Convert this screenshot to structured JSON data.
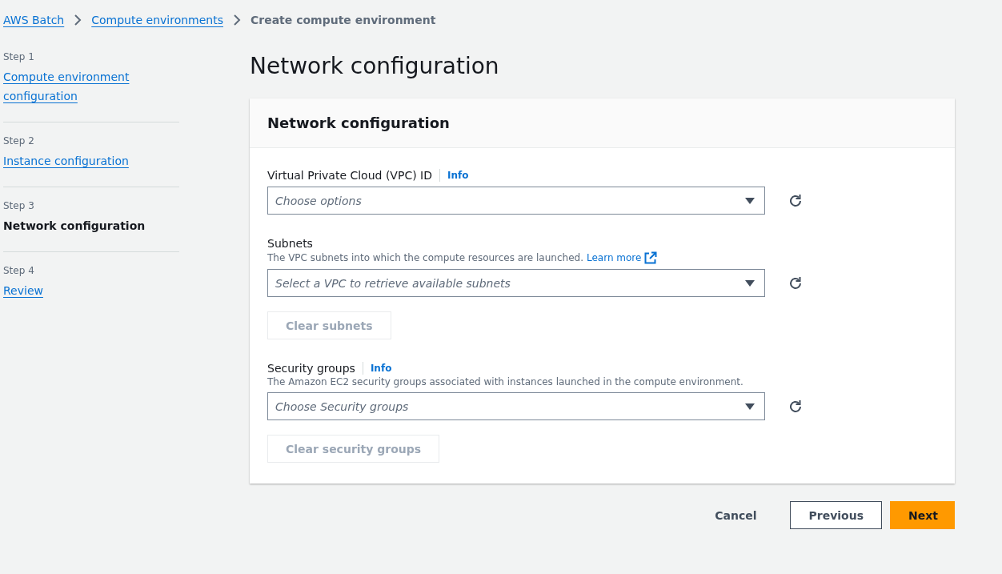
{
  "breadcrumb": [
    {
      "label": "AWS Batch",
      "link": true
    },
    {
      "label": "Compute environments",
      "link": true
    },
    {
      "label": "Create compute environment",
      "link": false
    }
  ],
  "steps": [
    {
      "step": "Step 1",
      "title": "Compute environment configuration",
      "selected": false
    },
    {
      "step": "Step 2",
      "title": "Instance configuration",
      "selected": false
    },
    {
      "step": "Step 3",
      "title": "Network configuration",
      "selected": true
    },
    {
      "step": "Step 4",
      "title": "Review",
      "selected": false
    }
  ],
  "page_title": "Network configuration",
  "panel": {
    "title": "Network configuration",
    "fields": [
      {
        "label": "Virtual Private Cloud (VPC) ID",
        "info": "Info",
        "placeholder": "Choose options"
      },
      {
        "label": "Subnets",
        "description": "The VPC subnets into which the compute resources are launched.",
        "learn_more": "Learn more",
        "placeholder": "Select a VPC to retrieve available subnets",
        "clear_button": {
          "label": "Clear subnets",
          "disabled": true
        }
      },
      {
        "label": "Security groups",
        "info": "Info",
        "description": "The Amazon EC2 security groups associated with instances launched in the compute environment.",
        "placeholder": "Choose Security groups",
        "clear_button": {
          "label": "Clear security groups",
          "disabled": true
        }
      }
    ]
  },
  "actions": {
    "cancel": "Cancel",
    "previous": "Previous",
    "next": "Next"
  }
}
